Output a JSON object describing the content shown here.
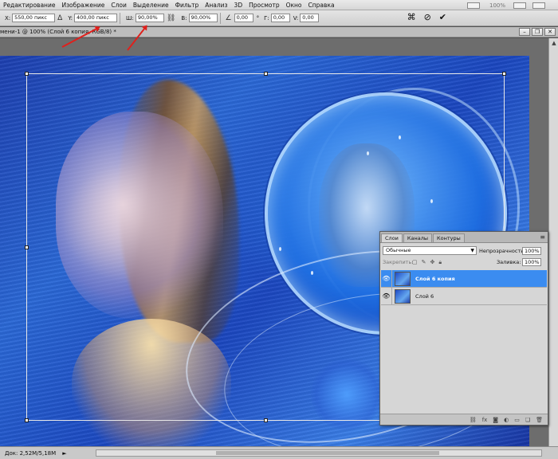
{
  "menubar": {
    "items": [
      "Редактирование",
      "Изображение",
      "Слои",
      "Выделение",
      "Фильтр",
      "Анализ",
      "3D",
      "Просмотр",
      "Окно",
      "Справка"
    ],
    "zoom_value": "100%"
  },
  "options": {
    "x_label": "X:",
    "x_value": "550,00 пикс",
    "y_label": "Y:",
    "y_value": "400,00 пикс",
    "w_label": "Ш:",
    "w_value": "90,00%",
    "h_label": "В:",
    "h_value": "90,00%",
    "angle_value": "0,00",
    "angle_unit": "°",
    "hskew_label": "Г:",
    "hskew_value": "0,00",
    "vskew_label": "V:",
    "vskew_value": "0,00",
    "icons": [
      "reference-point-icon",
      "link-icon",
      "angle-icon",
      "warp-icon",
      "cancel-icon",
      "commit-icon"
    ]
  },
  "document": {
    "tab_title": "мени-1 @ 100% (Слой 6 копия, RGB/8) *"
  },
  "layers_panel": {
    "tabs": [
      "Слои",
      "Каналы",
      "Контуры"
    ],
    "active_tab": "Слои",
    "blend_mode": "Обычные",
    "opacity_label": "Непрозрачность:",
    "opacity_value": "100%",
    "lock_label": "Закрепить:",
    "fill_label": "Заливка:",
    "fill_value": "100%",
    "layers": [
      {
        "name": "Слой 6 копия",
        "selected": true,
        "visible": true
      },
      {
        "name": "Слой 6",
        "selected": false,
        "visible": true
      }
    ]
  },
  "statusbar": {
    "doc_info": "Док: 2,52М/5,18М"
  },
  "colors": {
    "selection_blue": "#3b8cf0",
    "annotation_red": "#e0201c"
  }
}
